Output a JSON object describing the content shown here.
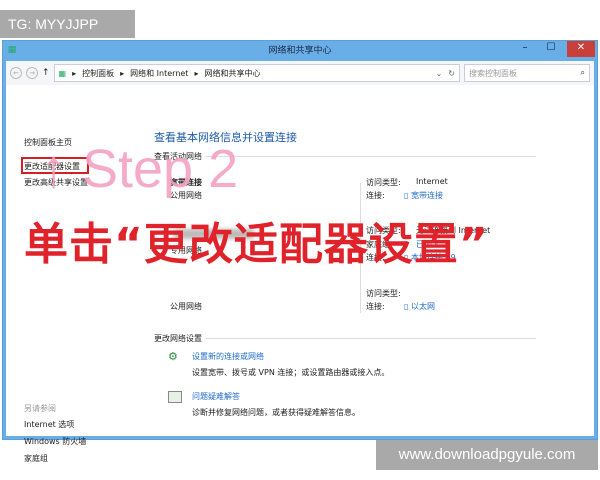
{
  "window": {
    "title": "网络和共享中心",
    "minimize": "–",
    "maximize": "☐",
    "close": "✕"
  },
  "address": {
    "path": [
      "控制面板",
      "网络和 Internet",
      "网络和共享中心"
    ],
    "search_placeholder": "搜索控制面板"
  },
  "sidebar": {
    "items": [
      "控制面板主页",
      "更改适配器设置",
      "更改高级共享设置"
    ],
    "see_also_title": "另请参阅",
    "see_also": [
      "Internet 选项",
      "Windows 防火墙",
      "家庭组"
    ]
  },
  "main": {
    "title": "查看基本网络信息并设置连接",
    "active_networks_title": "查看活动网络",
    "networks": [
      {
        "name": "宽带连接",
        "type": "公用网络",
        "access_label": "访问类型:",
        "access": "Internet",
        "conn_label": "连接:",
        "conn": "宽带连接"
      },
      {
        "name": "",
        "type": "专用网络",
        "access_label": "访问类型:",
        "access": "无法连接到 Internet",
        "homegroup_label": "家庭组:",
        "homegroup": "已加入",
        "conn_label": "连接:",
        "conn": "本地连接 19"
      },
      {
        "name": "",
        "type": "公用网络",
        "access_label": "访问类型:",
        "access": "",
        "conn_label": "连接:",
        "conn": "以太网"
      }
    ],
    "change_title": "更改网络设置",
    "tasks": [
      {
        "link": "设置新的连接或网络",
        "desc": "设置宽带、拨号或 VPN 连接；或设置路由器或接入点。",
        "icon": "network-setup-icon"
      },
      {
        "link": "问题疑难解答",
        "desc": "诊断并修复网络问题，或者获得疑难解答信息。",
        "icon": "troubleshoot-icon"
      }
    ]
  },
  "overlay": {
    "step": "↑ Step 2",
    "instruction": "单击“更改适配器设置”"
  },
  "watermarks": {
    "top": "TG: MYYJJPP",
    "bottom": "www.downloadpgyule.com"
  },
  "colors": {
    "frame": "#6aaee8",
    "link": "#1e6ac8",
    "highlight": "#d32027",
    "step": "#f5a3c3"
  }
}
